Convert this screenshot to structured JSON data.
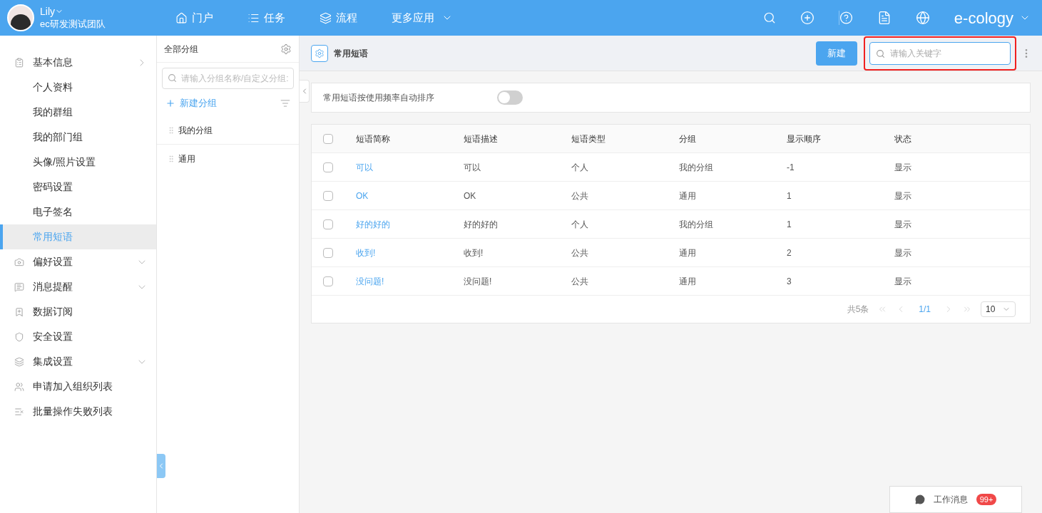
{
  "header": {
    "user_name": "Lily",
    "team": "ec研发测试团队",
    "nav": [
      {
        "label": "门户",
        "kind": "link",
        "selected": false
      },
      {
        "label": "任务",
        "kind": "link",
        "selected": false
      },
      {
        "label": "流程",
        "kind": "link",
        "selected": false
      },
      {
        "label": "更多应用",
        "kind": "menu",
        "selected": false
      }
    ],
    "brand": "e-cology"
  },
  "sidebar": {
    "items": [
      {
        "label": "基本信息",
        "kind": "group",
        "expanded": true,
        "selected": false
      },
      {
        "label": "个人资料",
        "kind": "sub",
        "selected": false
      },
      {
        "label": "我的群组",
        "kind": "sub",
        "selected": false
      },
      {
        "label": "我的部门组",
        "kind": "sub",
        "selected": false
      },
      {
        "label": "头像/照片设置",
        "kind": "sub",
        "selected": false
      },
      {
        "label": "密码设置",
        "kind": "sub",
        "selected": false
      },
      {
        "label": "电子签名",
        "kind": "sub",
        "selected": false
      },
      {
        "label": "常用短语",
        "kind": "sub",
        "selected": true
      },
      {
        "label": "偏好设置",
        "kind": "group",
        "expanded": false,
        "selected": false
      },
      {
        "label": "消息提醒",
        "kind": "group",
        "expanded": false,
        "selected": false
      },
      {
        "label": "数据订阅",
        "kind": "link",
        "selected": false
      },
      {
        "label": "安全设置",
        "kind": "link",
        "selected": false
      },
      {
        "label": "集成设置",
        "kind": "group",
        "expanded": false,
        "selected": false
      },
      {
        "label": "申请加入组织列表",
        "kind": "link",
        "selected": false
      },
      {
        "label": "批量操作失败列表",
        "kind": "link",
        "selected": false
      }
    ]
  },
  "groups": {
    "title": "全部分组",
    "search_placeholder": "请输入分组名称/自定义分组:",
    "new_group": "新建分组",
    "items": [
      {
        "label": "我的分组"
      },
      {
        "label": "通用"
      }
    ]
  },
  "main": {
    "title": "常用短语",
    "new_button": "新建",
    "search_placeholder": "请输入关键字",
    "auto_sort": {
      "label": "常用短语按使用频率自动排序",
      "on": false
    },
    "table": {
      "all_checked": false,
      "columns": [
        "短语简称",
        "短语描述",
        "短语类型",
        "分组",
        "显示顺序",
        "状态"
      ],
      "rows": [
        {
          "checked": false,
          "cells": [
            "可以",
            "可以",
            "个人",
            "我的分组",
            "-1",
            "显示"
          ]
        },
        {
          "checked": false,
          "cells": [
            "OK",
            "OK",
            "公共",
            "通用",
            "1",
            "显示"
          ]
        },
        {
          "checked": false,
          "cells": [
            "好的好的",
            "好的好的",
            "个人",
            "我的分组",
            "1",
            "显示"
          ]
        },
        {
          "checked": false,
          "cells": [
            "收到!",
            "收到!",
            "公共",
            "通用",
            "2",
            "显示"
          ]
        },
        {
          "checked": false,
          "cells": [
            "没问题!",
            "没问题!",
            "公共",
            "通用",
            "3",
            "显示"
          ]
        }
      ]
    },
    "pagination": {
      "total": "共5条",
      "page": "1/1",
      "page_size": "10"
    }
  },
  "messages": {
    "label": "工作消息",
    "badge": "99+"
  }
}
